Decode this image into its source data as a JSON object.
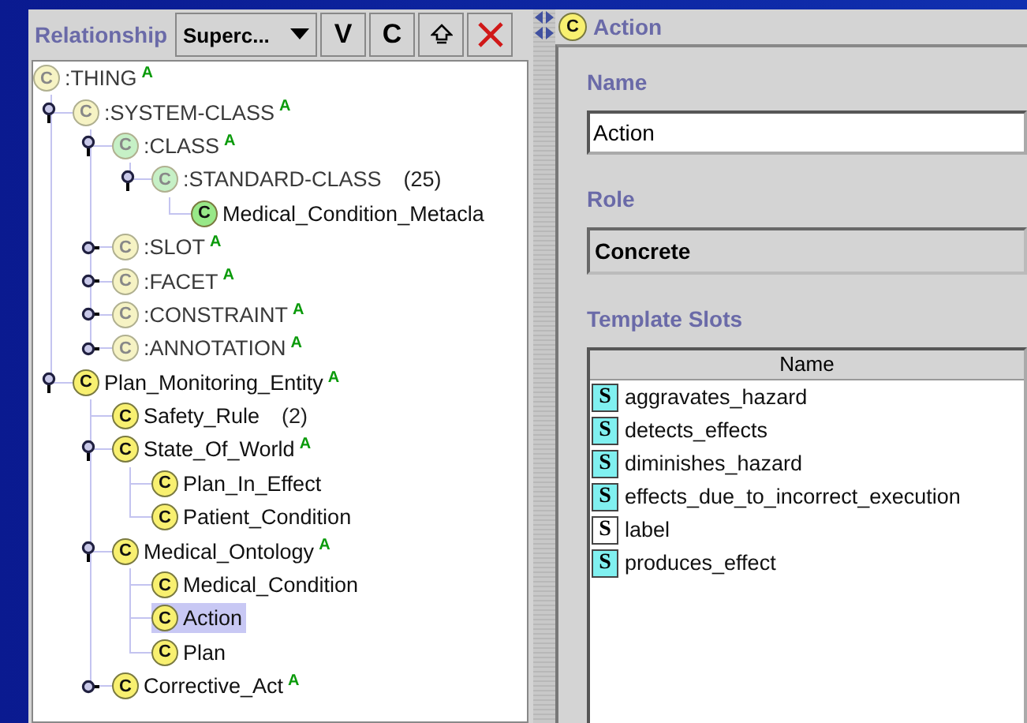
{
  "left_panel": {
    "header": {
      "label": "Relationship",
      "dropdown": {
        "value": "Superc..."
      },
      "buttons": [
        {
          "kind": "text",
          "label": "V"
        },
        {
          "kind": "text",
          "label": "C"
        },
        {
          "kind": "up_arrow"
        },
        {
          "kind": "delete"
        }
      ]
    },
    "tree": [
      {
        "icon": "C",
        "color": "#f6f3c4",
        "system": true,
        "name": ":THING",
        "badge": "A",
        "selected": false,
        "children": [
          {
            "icon": "C",
            "color": "#f6f3c4",
            "system": true,
            "name": ":SYSTEM-CLASS",
            "badge": "A",
            "selected": false,
            "expanded": true,
            "children": [
              {
                "icon": "C",
                "color": "#c6f0c6",
                "system": true,
                "name": ":CLASS",
                "badge": "A",
                "selected": false,
                "expanded": true,
                "children": [
                  {
                    "icon": "C",
                    "color": "#c6f0c6",
                    "system": true,
                    "name": ":STANDARD-CLASS",
                    "count": "(25)",
                    "selected": false,
                    "expanded": true,
                    "children": [
                      {
                        "icon": "C",
                        "color": "#98e888",
                        "system": false,
                        "name": "Medical_Condition_Metacla",
                        "selected": false
                      }
                    ]
                  }
                ]
              },
              {
                "icon": "C",
                "color": "#f6f3c4",
                "system": true,
                "name": ":SLOT",
                "badge": "A",
                "selected": false,
                "expanded": false
              },
              {
                "icon": "C",
                "color": "#f6f3c4",
                "system": true,
                "name": ":FACET",
                "badge": "A",
                "selected": false,
                "expanded": false
              },
              {
                "icon": "C",
                "color": "#f6f3c4",
                "system": true,
                "name": ":CONSTRAINT",
                "badge": "A",
                "selected": false,
                "expanded": false
              },
              {
                "icon": "C",
                "color": "#f6f3c4",
                "system": true,
                "name": ":ANNOTATION",
                "badge": "A",
                "selected": false,
                "expanded": false
              }
            ]
          },
          {
            "icon": "C",
            "color": "#f8f070",
            "system": false,
            "name": "Plan_Monitoring_Entity",
            "badge": "A",
            "selected": false,
            "expanded": true,
            "children": [
              {
                "icon": "C",
                "color": "#f8f070",
                "system": false,
                "name": "Safety_Rule",
                "count": "(2)",
                "selected": false
              },
              {
                "icon": "C",
                "color": "#f8f070",
                "system": false,
                "name": "State_Of_World",
                "badge": "A",
                "selected": false,
                "expanded": true,
                "children": [
                  {
                    "icon": "C",
                    "color": "#f8f070",
                    "system": false,
                    "name": "Plan_In_Effect",
                    "selected": false
                  },
                  {
                    "icon": "C",
                    "color": "#f8f070",
                    "system": false,
                    "name": "Patient_Condition",
                    "selected": false
                  }
                ]
              },
              {
                "icon": "C",
                "color": "#f8f070",
                "system": false,
                "name": "Medical_Ontology",
                "badge": "A",
                "selected": false,
                "expanded": true,
                "children": [
                  {
                    "icon": "C",
                    "color": "#f8f070",
                    "system": false,
                    "name": "Medical_Condition",
                    "selected": false
                  },
                  {
                    "icon": "C",
                    "color": "#f8f070",
                    "system": false,
                    "name": "Action",
                    "selected": true
                  },
                  {
                    "icon": "C",
                    "color": "#f8f070",
                    "system": false,
                    "name": "Plan",
                    "selected": false
                  }
                ]
              },
              {
                "icon": "C",
                "color": "#f8f070",
                "system": false,
                "name": "Corrective_Act",
                "badge": "A",
                "selected": false,
                "expanded": false
              }
            ]
          }
        ]
      }
    ]
  },
  "right_panel": {
    "title": {
      "icon": "C",
      "color": "#f8f070",
      "text": "Action"
    },
    "name_field": {
      "label": "Name",
      "value": "Action"
    },
    "role": {
      "label": "Role",
      "value": "Concrete"
    },
    "template_slots": {
      "label": "Template Slots",
      "columns": [
        "Name"
      ],
      "rows": [
        {
          "icon": "S",
          "color": "#80f0f0",
          "name": "aggravates_hazard"
        },
        {
          "icon": "S",
          "color": "#80f0f0",
          "name": "detects_effects"
        },
        {
          "icon": "S",
          "color": "#80f0f0",
          "name": "diminishes_hazard"
        },
        {
          "icon": "S",
          "color": "#80f0f0",
          "name": "effects_due_to_incorrect_execution"
        },
        {
          "icon": "S",
          "color": "#ffffff",
          "name": "label"
        },
        {
          "icon": "S",
          "color": "#80f0f0",
          "name": "produces_effect"
        }
      ]
    }
  }
}
